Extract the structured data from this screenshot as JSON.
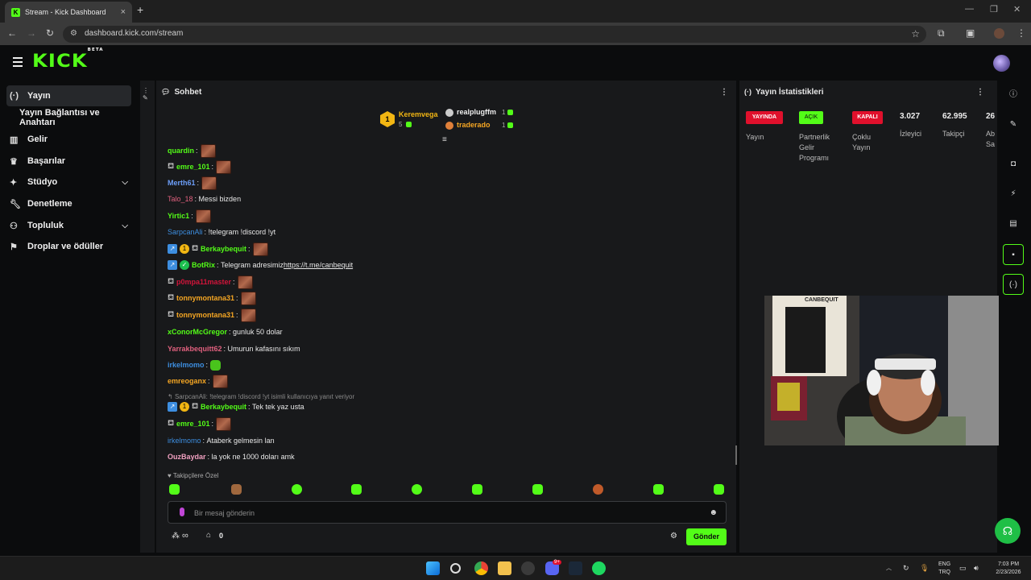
{
  "browser": {
    "tab_title": "Stream - Kick Dashboard",
    "url": "dashboard.kick.com/stream"
  },
  "header": {
    "logo": "KICK",
    "logo_badge": "BETA"
  },
  "sidebar": {
    "items": [
      {
        "label": "Yayın",
        "icon": "broadcast-icon"
      },
      {
        "label": "Yayın Bağlantısı ve Anahtarı"
      },
      {
        "label": "Gelir",
        "icon": "revenue-icon"
      },
      {
        "label": "Başarılar",
        "icon": "trophy-icon"
      },
      {
        "label": "Stüdyo",
        "icon": "studio-icon"
      },
      {
        "label": "Denetleme",
        "icon": "wrench-icon"
      },
      {
        "label": "Topluluk",
        "icon": "community-icon"
      },
      {
        "label": "Droplar ve ödüller",
        "icon": "gift-icon"
      }
    ]
  },
  "chat": {
    "title": "Sohbet",
    "leaderboard": {
      "first_name": "Keremvega",
      "first_count": "5",
      "second_name": "realplugffm",
      "second_count": "1",
      "third_name": "traderado",
      "third_count": "1"
    },
    "messages": [
      {
        "user": "quardin",
        "text": "",
        "color": "#53fc18"
      },
      {
        "user": "emre_101",
        "text": "",
        "color": "#53fc18"
      },
      {
        "user": "Merth61",
        "text": "",
        "color": "#6c9ef8"
      },
      {
        "user": "Talo_18",
        "text": "Messi bizden",
        "color": "#e0607e"
      },
      {
        "user": "Yirtic1",
        "text": "",
        "color": "#53fc18"
      },
      {
        "user": "SarpcanAli",
        "text": "!telegram !discord !yt",
        "color": "#3d8ee0"
      },
      {
        "user": "Berkaybequit",
        "text": "",
        "color": "#53fc18"
      },
      {
        "user": "BotRix",
        "text": "Telegram adresimiz ",
        "link": "https://t.me/canbequit",
        "color": "#53fc18"
      },
      {
        "user": "p0mpa11master",
        "text": "",
        "color": "#d2143a"
      },
      {
        "user": "tonnymontana31",
        "text": "",
        "color": "#f5a623"
      },
      {
        "user": "tonnymontana31",
        "text": "",
        "color": "#f5a623"
      },
      {
        "user": "xConorMcGregor",
        "text": "gunluk 50 dolar",
        "color": "#53fc18"
      },
      {
        "user": "Yarrakbequitt62",
        "text": "Umurun kafasını sıkım",
        "color": "#e0607e"
      },
      {
        "user": "irkelmomo",
        "text": "",
        "color": "#3d8ee0"
      },
      {
        "user": "emreoganx",
        "text": "",
        "color": "#f5a623"
      },
      {
        "user": "Berkaybequit",
        "text": "Tek tek yaz usta",
        "color": "#53fc18"
      },
      {
        "user": "emre_101",
        "text": "",
        "color": "#53fc18"
      },
      {
        "user": "irkelmomo",
        "text": "Ataberk gelmesin lan",
        "color": "#3d8ee0"
      },
      {
        "user": "OuzBaydar",
        "text": "la yok ne 1000 doları amk",
        "color": "#f0a0c0"
      }
    ],
    "reply_context": "SarpcanAli: !telegram !discord !yt isimli kullanıcıya yanıt veriyor",
    "followers_only": "Takipçilere Özel",
    "input_placeholder": "Bir mesaj gönderin",
    "points": "∞",
    "store_count": "0",
    "send_label": "Gönder"
  },
  "stats": {
    "title": "Yayın İstatistikleri",
    "live_pill": "YAYINDA",
    "live_label": "Yayın",
    "partner_pill": "AÇIK",
    "partner_label_1": "Partnerlik",
    "partner_label_2": "Gelir",
    "partner_label_3": "Programı",
    "multi_pill": "KAPALI",
    "multi_label_1": "Çoklu",
    "multi_label_2": "Yayın",
    "viewers_value": "3.027",
    "viewers_label": "İzleyici",
    "followers_value": "62.995",
    "followers_label": "Takipçi",
    "subs_value": "26",
    "subs_label_1": "Ab",
    "subs_label_2": "Sa"
  },
  "webcam": {
    "poster_text": "CANBEQUIT"
  },
  "taskbar": {
    "lang_1": "ENG",
    "lang_2": "TRQ",
    "time": "7:03 PM",
    "date": "2/23/2026",
    "discord_badge": "9+"
  },
  "colors": {
    "accent": "#53fc18",
    "live_red": "#e0102c",
    "panel_bg": "#18191b"
  }
}
